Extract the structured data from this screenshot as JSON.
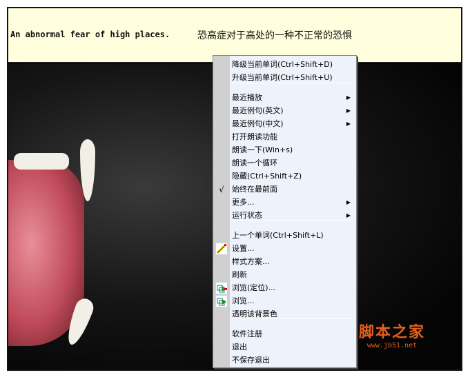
{
  "banner": {
    "english": "An abnormal fear of high places.",
    "chinese": "恐高症对于高处的一种不正常的恐惧"
  },
  "menu": {
    "items": [
      {
        "label": "降级当前单词(Ctrl+Shift+D)"
      },
      {
        "label": "升级当前单词(Ctrl+Shift+U)"
      },
      {
        "label": "最近播放",
        "submenu": true
      },
      {
        "label": "最近例句(英文)",
        "submenu": true
      },
      {
        "label": "最近例句(中文)",
        "submenu": true
      },
      {
        "label": "打开朗读功能"
      },
      {
        "label": "朗读一下(Win+s)"
      },
      {
        "label": "朗读一个循环"
      },
      {
        "label": "隐藏(Ctrl+Shift+Z)"
      },
      {
        "label": "始终在最前面",
        "checked": true
      },
      {
        "label": "更多...",
        "submenu": true
      },
      {
        "label": "运行状态",
        "submenu": true
      },
      {
        "label": "上一个单词(Ctrl+Shift+L)"
      },
      {
        "label": "设置...",
        "icon": "pencil-icon"
      },
      {
        "label": "样式方案..."
      },
      {
        "label": "刷新"
      },
      {
        "label": "浏览(定位)...",
        "icon": "browse-locate-icon"
      },
      {
        "label": "浏览...",
        "icon": "browse-icon"
      },
      {
        "label": "透明该背景色"
      },
      {
        "label": "软件注册"
      },
      {
        "label": "退出"
      },
      {
        "label": "不保存退出"
      }
    ],
    "check_glyph": "√",
    "arrow_glyph": "▶"
  },
  "watermark": {
    "title": "脚本之家",
    "url": "www.jb51.net"
  }
}
